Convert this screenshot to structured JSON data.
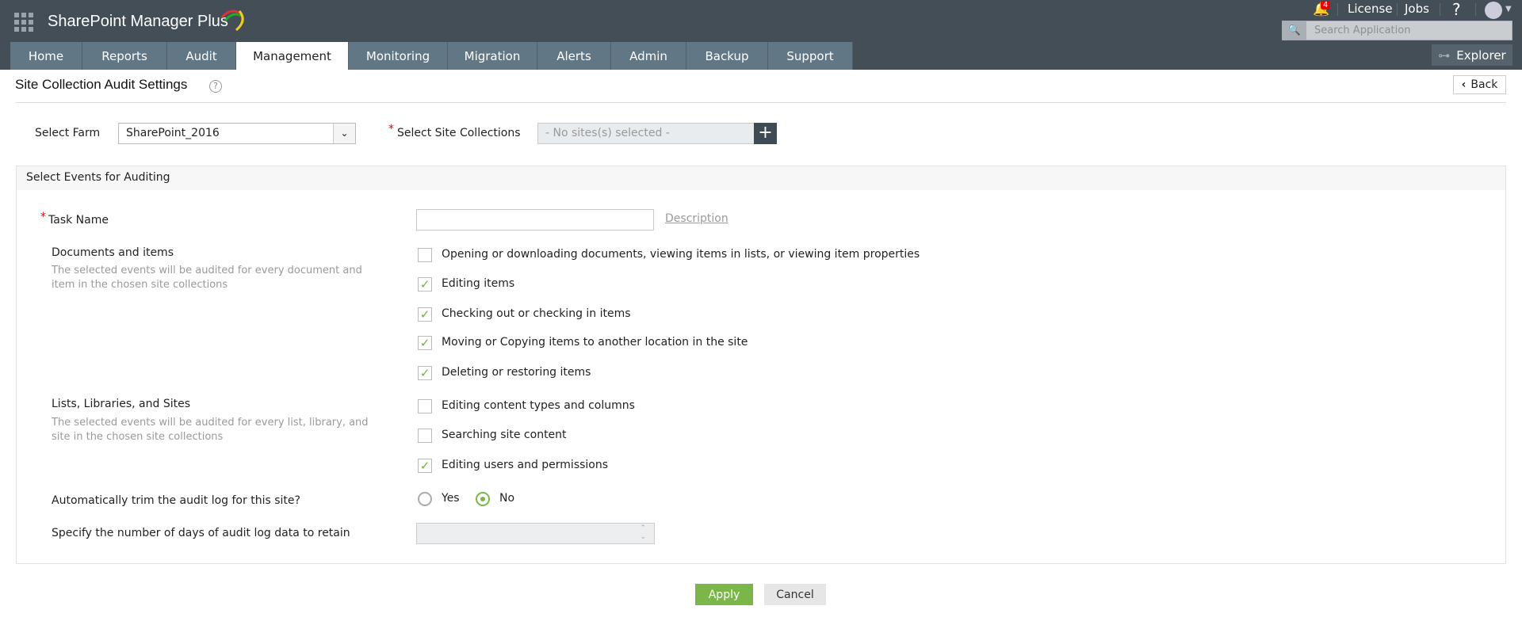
{
  "app": {
    "name": "SharePoint Manager Plus",
    "notification_count": "4",
    "license": "License",
    "jobs": "Jobs",
    "help": "?",
    "search_placeholder": "Search Application",
    "explorer": "Explorer"
  },
  "tabs": [
    {
      "label": "Home"
    },
    {
      "label": "Reports"
    },
    {
      "label": "Audit"
    },
    {
      "label": "Management",
      "active": true
    },
    {
      "label": "Monitoring"
    },
    {
      "label": "Migration"
    },
    {
      "label": "Alerts"
    },
    {
      "label": "Admin"
    },
    {
      "label": "Backup"
    },
    {
      "label": "Support"
    }
  ],
  "page": {
    "title": "Site Collection Audit Settings",
    "help": "?",
    "back": "Back"
  },
  "farm": {
    "label": "Select Farm",
    "value": "SharePoint_2016"
  },
  "sites": {
    "label": "Select Site Collections",
    "placeholder": "- No sites(s) selected -"
  },
  "section": {
    "title": "Select Events for Auditing",
    "task_label": "Task Name",
    "task_value": "",
    "description_link": "Description",
    "docs": {
      "title": "Documents and items",
      "desc": "The selected events will be audited for every document and item in the chosen site collections"
    },
    "lists": {
      "title": "Lists, Libraries, and Sites",
      "desc": "The selected events will be audited for every list, library, and site in the chosen site collections"
    },
    "events": [
      {
        "label": "Opening or downloading documents, viewing items in lists, or viewing item properties",
        "checked": false
      },
      {
        "label": "Editing items",
        "checked": true
      },
      {
        "label": "Checking out or checking in items",
        "checked": true
      },
      {
        "label": "Moving or Copying items to another location in the site",
        "checked": true
      },
      {
        "label": "Deleting or restoring items",
        "checked": true
      },
      {
        "label": "Editing content types and columns",
        "checked": false
      },
      {
        "label": "Searching site content",
        "checked": false
      },
      {
        "label": "Editing users and permissions",
        "checked": true
      }
    ],
    "trim_label": "Automatically trim the audit log for this site?",
    "yes": "Yes",
    "no": "No",
    "trim_value": "No",
    "days_label": "Specify the number of days of audit log data to retain",
    "days_value": ""
  },
  "actions": {
    "apply": "Apply",
    "cancel": "Cancel"
  },
  "colors": {
    "header": "#434e57",
    "tab": "#617786",
    "accent": "#7ab648"
  }
}
